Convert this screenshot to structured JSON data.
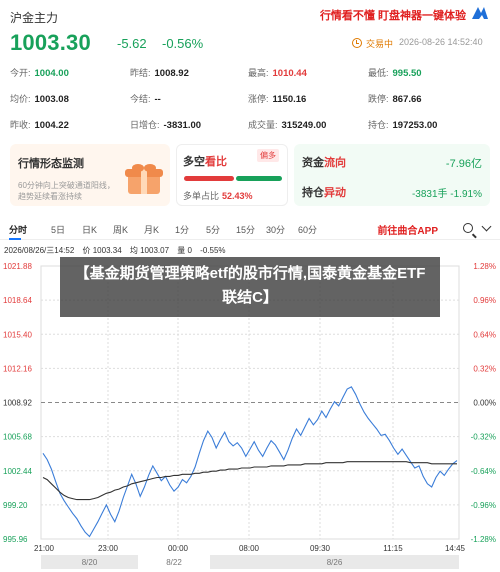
{
  "header": {
    "title": "沪金主力",
    "promo": "行情看不懂 盯盘神器一键体验",
    "price": "1003.30",
    "change": "-5.62",
    "change_pct": "-0.56%",
    "status": "交易中",
    "time": "2026-08-26 14:52:40"
  },
  "stats": [
    {
      "label": "今开:",
      "value": "1004.00",
      "color": "green"
    },
    {
      "label": "昨结:",
      "value": "1008.92",
      "color": ""
    },
    {
      "label": "最高:",
      "value": "1010.44",
      "color": "red"
    },
    {
      "label": "最低:",
      "value": "995.50",
      "color": "green"
    },
    {
      "label": "均价:",
      "value": "1003.08",
      "color": ""
    },
    {
      "label": "今结:",
      "value": "--",
      "color": ""
    },
    {
      "label": "涨停:",
      "value": "1150.16",
      "color": ""
    },
    {
      "label": "跌停:",
      "value": "867.66",
      "color": ""
    },
    {
      "label": "昨收:",
      "value": "1004.22",
      "color": ""
    },
    {
      "label": "日增仓:",
      "value": "-3831.00",
      "color": ""
    },
    {
      "label": "成交量:",
      "value": "315249.00",
      "color": ""
    },
    {
      "label": "持仓:",
      "value": "197253.00",
      "color": ""
    }
  ],
  "cards": {
    "pattern_title": "行情形态监测",
    "pattern_desc": "60分钟向上突破通道阳线，趋势延续看涨持续",
    "longshort_title_a": "多空",
    "longshort_title_b": "看比",
    "longshort_tag": "偏多",
    "longshort_ratio_label": "多单占比",
    "longshort_ratio": "52.43%",
    "fund_label_a": "资金",
    "fund_label_b": "流向",
    "fund_value": "-7.96亿",
    "pos_label_a": "持仓",
    "pos_label_b": "异动",
    "pos_value": "-3831手 -1.91%"
  },
  "tabs": [
    "分时",
    "5日",
    "日K",
    "周K",
    "月K",
    "1分",
    "5分",
    "15分",
    "30分",
    "60分"
  ],
  "app_link": "前往曲合APP",
  "info": {
    "time": "2026/08/26/三14:52",
    "price": "价 1003.34",
    "avg": "均 1003.07",
    "vol": "量 0",
    "pct": "-0.55%"
  },
  "overlay": {
    "text": "【基金期货管理策略etf的股市行情,国泰黄金基金ETF联结C】"
  },
  "chart_data": {
    "type": "line",
    "y_ticks_left": [
      "1021.88",
      "1018.64",
      "1015.40",
      "1012.16",
      "1008.92",
      "1005.68",
      "1002.44",
      "999.20",
      "995.96"
    ],
    "y_ticks_right": [
      "1.28%",
      "0.96%",
      "0.64%",
      "0.32%",
      "0.00%",
      "-0.32%",
      "-0.64%",
      "-0.96%",
      "-1.28%"
    ],
    "ylim": [
      995.96,
      1021.88
    ],
    "x_ticks": [
      "21:00",
      "23:00",
      "00:00",
      "08:00",
      "09:30",
      "11:15",
      "14:45"
    ],
    "x_dates": [
      "8/20",
      "8/22",
      "8/26"
    ],
    "reference_price": 1008.92,
    "colors": {
      "price": "#3b7dd8",
      "avg": "#333333",
      "grid": "#dddddd"
    },
    "series": [
      {
        "values": [
          1004.1,
          1003.5,
          1002.6,
          1001.4,
          1000.3,
          999.6,
          999.0,
          998.4,
          997.9,
          997.2,
          996.6,
          996.2,
          996.9,
          997.6,
          998.4,
          999.2,
          998.3,
          997.6,
          998.6,
          999.9,
          1001.0,
          1002.1,
          1001.2,
          1000.0,
          1000.9,
          1002.0,
          1002.9,
          1002.2,
          1001.5,
          1001.9,
          1001.1,
          1000.5,
          1000.9,
          1001.6,
          1001.3,
          1001.9,
          1002.8,
          1004.1,
          1005.3,
          1006.2,
          1005.6,
          1004.6,
          1005.4,
          1006.1,
          1005.2,
          1004.8,
          1005.1,
          1004.6,
          1003.8,
          1004.5,
          1005.2,
          1004.4,
          1003.8,
          1004.6,
          1005.3,
          1004.9,
          1004.2,
          1003.5,
          1004.4,
          1005.5,
          1006.4,
          1005.8,
          1006.6,
          1007.4,
          1006.8,
          1007.3,
          1008.1,
          1007.5,
          1008.3,
          1009.0,
          1008.6,
          1009.4,
          1010.2,
          1010.4,
          1009.7,
          1008.8,
          1008.0,
          1007.4,
          1006.9,
          1006.4,
          1005.8,
          1005.9,
          1005.3,
          1004.6,
          1004.0,
          1004.5,
          1003.9,
          1003.3,
          1002.7,
          1002.9,
          1001.9,
          1001.2,
          1000.9,
          1001.8,
          1002.4,
          1002.0,
          1002.6,
          1003.1,
          1003.4
        ]
      },
      {
        "values": [
          1001.8,
          1001.6,
          1001.2,
          1000.8,
          1000.4,
          1000.1,
          999.9,
          999.8,
          999.7,
          999.7,
          999.7,
          999.7,
          999.8,
          999.9,
          1000.1,
          1000.3,
          1000.4,
          1000.6,
          1000.7,
          1000.9,
          1001.0,
          1001.2,
          1001.3,
          1001.4,
          1001.5,
          1001.6,
          1001.7,
          1001.8,
          1001.8,
          1001.9,
          1001.9,
          1002.0,
          1002.0,
          1002.1,
          1002.1,
          1002.1,
          1002.2,
          1002.2,
          1002.3,
          1002.3,
          1002.4,
          1002.4,
          1002.5,
          1002.5,
          1002.6,
          1002.6,
          1002.6,
          1002.7,
          1002.7,
          1002.7,
          1002.8,
          1002.8,
          1002.8,
          1002.8,
          1002.9,
          1002.9,
          1002.9,
          1002.9,
          1003.0,
          1003.0,
          1003.0,
          1003.0,
          1003.1,
          1003.1,
          1003.1,
          1003.1,
          1003.1,
          1003.2,
          1003.2,
          1003.2,
          1003.2,
          1003.2,
          1003.3,
          1003.3,
          1003.3,
          1003.3,
          1003.3,
          1003.3,
          1003.3,
          1003.3,
          1003.3,
          1003.3,
          1003.3,
          1003.3,
          1003.3,
          1003.3,
          1003.3,
          1003.2,
          1003.2,
          1003.2,
          1003.2,
          1003.2,
          1003.1,
          1003.1,
          1003.1,
          1003.1,
          1003.1,
          1003.1,
          1003.1
        ]
      }
    ]
  }
}
